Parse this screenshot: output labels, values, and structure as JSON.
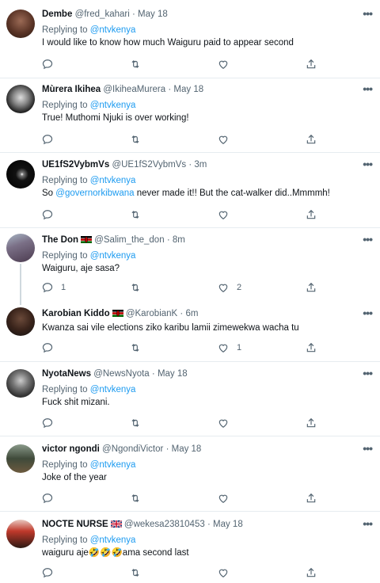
{
  "tweets": [
    {
      "name": "Dembe",
      "handle": "@fred_kahari",
      "sep": "·",
      "time": "May 18",
      "replying_prefix": "Replying to ",
      "replying_to": "@ntvkenya",
      "text": "I would like to know how much Waiguru paid to appear second",
      "mention": "",
      "reply_count": "",
      "like_count": ""
    },
    {
      "name": "Mùrera Ikihea",
      "handle": "@IkiheaMurera",
      "sep": "·",
      "time": "May 18",
      "replying_prefix": "Replying to ",
      "replying_to": "@ntvkenya",
      "text": "True! Muthomi Njuki is over working!",
      "mention": "",
      "reply_count": "",
      "like_count": ""
    },
    {
      "name": "UE1fS2VybmVs",
      "handle": "@UE1fS2VybmVs",
      "sep": "·",
      "time": "3m",
      "replying_prefix": "Replying to ",
      "replying_to": "@ntvkenya",
      "text_pre": "So ",
      "mention": "@governorkibwana",
      "text": " never made it!! But the cat-walker did..Mmmmh!",
      "reply_count": "",
      "like_count": ""
    },
    {
      "name": "The Don",
      "handle": "@Salim_the_don",
      "sep": "·",
      "time": "8m",
      "replying_prefix": "Replying to ",
      "replying_to": "@ntvkenya",
      "text": "Waiguru, aje sasa?",
      "mention": "",
      "reply_count": "1",
      "like_count": "2"
    },
    {
      "name": "Karobian Kiddo",
      "handle": "@KarobianK",
      "sep": "·",
      "time": "6m",
      "text": "Kwanza sai vile elections ziko karibu lamii zimewekwa wacha tu",
      "mention": "",
      "reply_count": "",
      "like_count": "1"
    },
    {
      "name": "NyotaNews",
      "handle": "@NewsNyota",
      "sep": "·",
      "time": "May 18",
      "replying_prefix": "Replying to ",
      "replying_to": "@ntvkenya",
      "text": "Fuck shit mizani.",
      "mention": "",
      "reply_count": "",
      "like_count": ""
    },
    {
      "name": "victor ngondi",
      "handle": "@NgondiVictor",
      "sep": "·",
      "time": "May 18",
      "replying_prefix": "Replying to ",
      "replying_to": "@ntvkenya",
      "text": "Joke of the year",
      "mention": "",
      "reply_count": "",
      "like_count": ""
    },
    {
      "name": "NOCTE NURSE",
      "handle": "@wekesa23810453",
      "sep": "·",
      "time": "May 18",
      "replying_prefix": "Replying to ",
      "replying_to": "@ntvkenya",
      "text_pre": "waiguru aje",
      "emoji": "🤣🤣🤣",
      "text": "ama second last",
      "mention": "",
      "reply_count": "",
      "like_count": ""
    }
  ],
  "more_glyph": "•••",
  "colors": {
    "link": "#1d9bf0",
    "muted": "#536471",
    "divider": "#e6ecf0"
  },
  "icons": [
    "reply-icon",
    "retweet-icon",
    "like-icon",
    "share-icon",
    "more-icon"
  ]
}
